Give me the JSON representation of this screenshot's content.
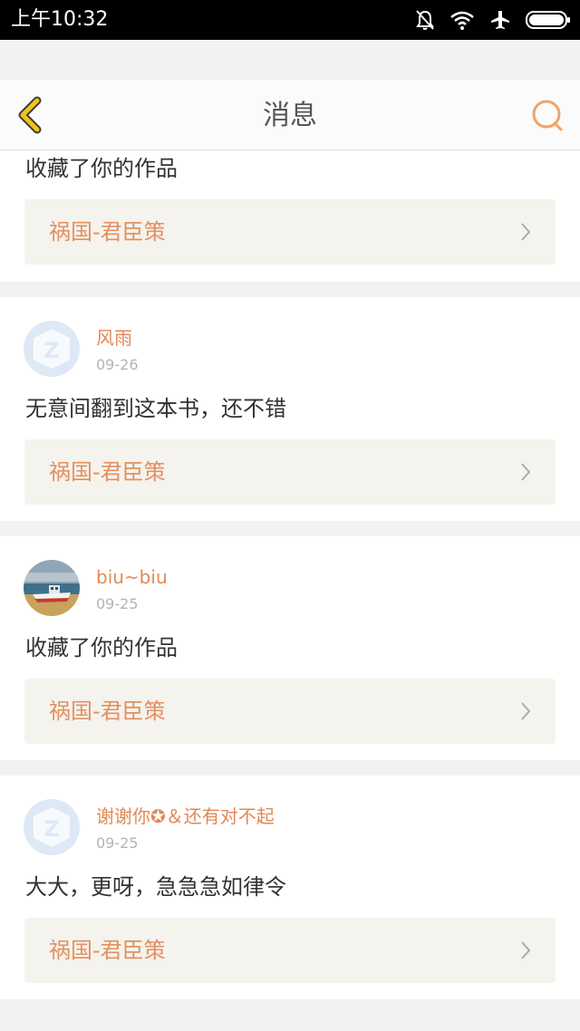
{
  "status_bar": {
    "time": "上午10:32"
  },
  "header": {
    "title": "消息"
  },
  "messages": [
    {
      "text": "收藏了你的作品",
      "book": "祸国-君臣策"
    },
    {
      "user": "风雨",
      "date": "09-26",
      "text": "无意间翻到这本书，还不错",
      "book": "祸国-君臣策",
      "avatar": "default-avatar-icon"
    },
    {
      "user": "biu~biu",
      "date": "09-25",
      "text": "收藏了你的作品",
      "book": "祸国-君臣策",
      "avatar": "boat-photo-avatar"
    },
    {
      "user": "谢谢你✪＆还有对不起",
      "date": "09-25",
      "text": "大大，更呀，急急急如律令",
      "book": "祸国-君臣策",
      "avatar": "default-avatar-icon"
    }
  ],
  "colors": {
    "accent": "#e5905f",
    "status_bar": "#000000",
    "back_icon": "#f0c419"
  }
}
